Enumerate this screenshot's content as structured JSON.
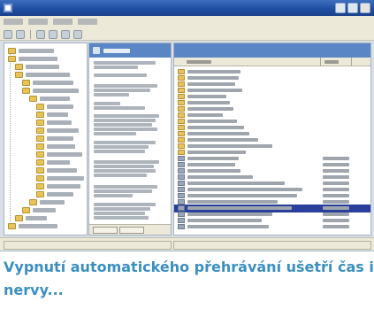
{
  "window": {
    "title": ""
  },
  "tree": {
    "items": [
      {
        "label": ""
      },
      {
        "label": ""
      },
      {
        "label": ""
      },
      {
        "label": ""
      },
      {
        "label": ""
      },
      {
        "label": ""
      },
      {
        "label": ""
      },
      {
        "label": ""
      },
      {
        "label": ""
      },
      {
        "label": ""
      },
      {
        "label": ""
      },
      {
        "label": ""
      },
      {
        "label": ""
      },
      {
        "label": ""
      },
      {
        "label": ""
      },
      {
        "label": ""
      },
      {
        "label": ""
      },
      {
        "label": ""
      },
      {
        "label": ""
      },
      {
        "label": ""
      },
      {
        "label": ""
      },
      {
        "label": ""
      },
      {
        "label": ""
      }
    ]
  },
  "list": {
    "selected_index": 22,
    "rows": 26
  },
  "caption": {
    "text": "Vypnutí automatického přehrávání ušetří čas i nervy..."
  },
  "colors": {
    "caption": "#3b8fc1",
    "titlebar": "#1f4fa3",
    "selection": "#2a3f9c",
    "folder": "#e8c35a"
  }
}
